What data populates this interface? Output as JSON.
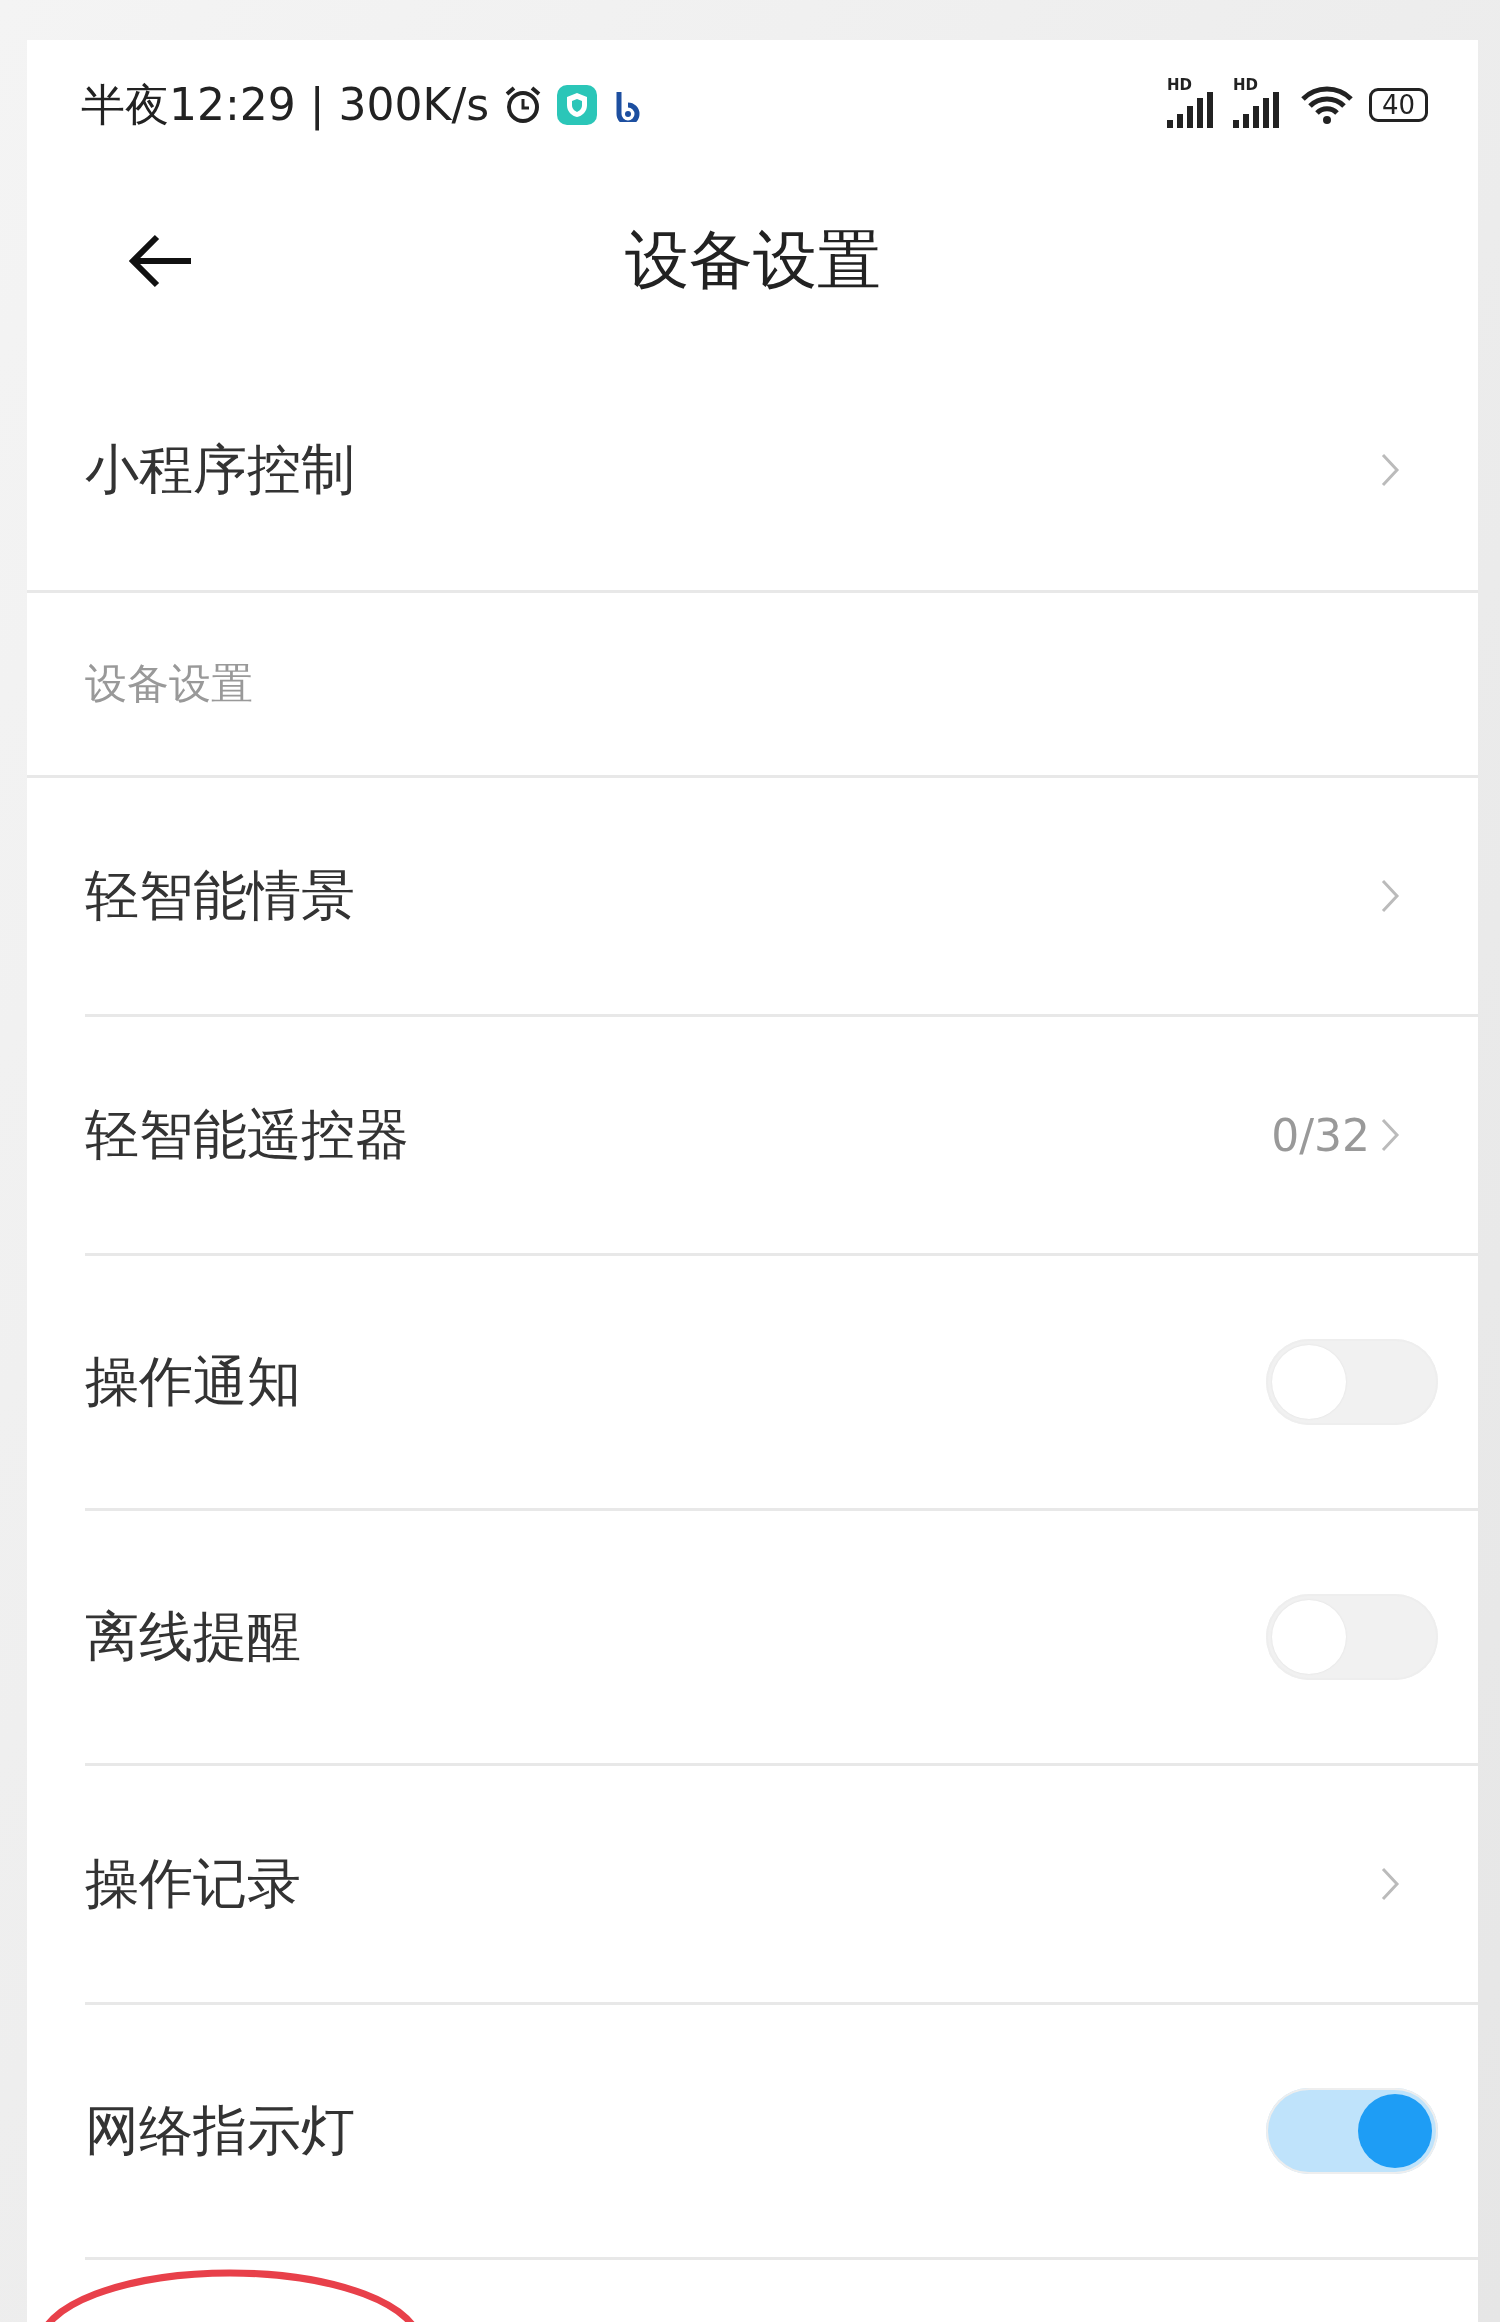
{
  "status_bar": {
    "time_speed": "半夜12:29 | 300K/s",
    "signal_labels": [
      "HD",
      "HD"
    ],
    "battery": "40"
  },
  "header": {
    "title": "设备设置"
  },
  "items": [
    {
      "kind": "link",
      "label": "小程序控制"
    },
    {
      "kind": "section",
      "label": "设备设置"
    },
    {
      "kind": "link",
      "label": "轻智能情景"
    },
    {
      "kind": "link",
      "label": "轻智能遥控器",
      "value": "0/32"
    },
    {
      "kind": "toggle",
      "label": "操作通知",
      "on": false
    },
    {
      "kind": "toggle",
      "label": "离线提醒",
      "on": false
    },
    {
      "kind": "link",
      "label": "操作记录"
    },
    {
      "kind": "toggle",
      "label": "网络指示灯",
      "on": true
    }
  ]
}
